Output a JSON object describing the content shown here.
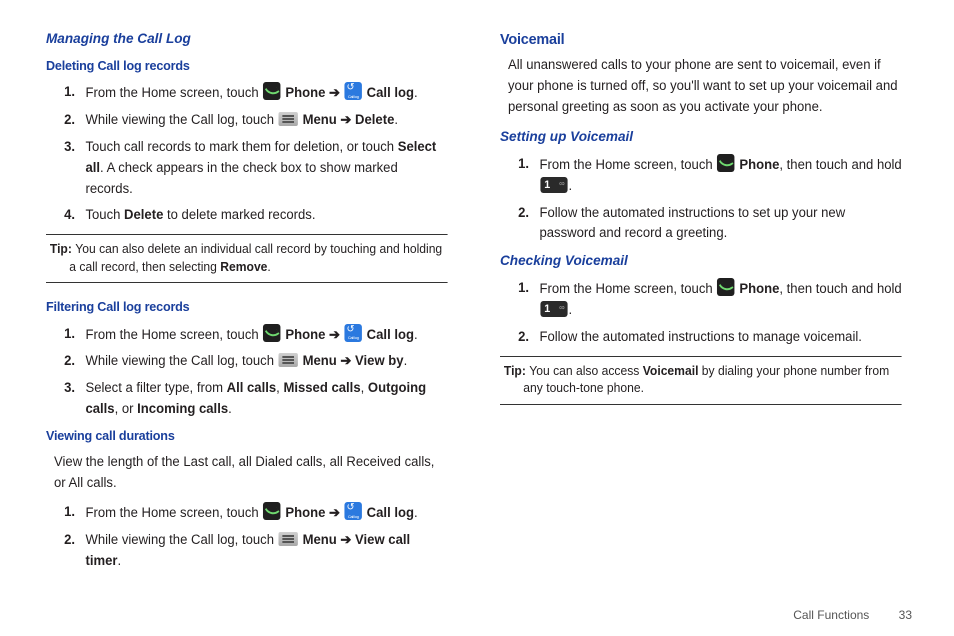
{
  "left": {
    "sectionTitle": "Managing the Call Log",
    "deleting": {
      "title": "Deleting Call log records",
      "steps": [
        {
          "pre": "From the Home screen, touch ",
          "icon1": "phone",
          "b1": " Phone ",
          "arrow": "➔",
          "icon2": "calllog",
          "b2": " Call log",
          "post": "."
        },
        {
          "pre": "While viewing the Call log, touch ",
          "icon1": "menu",
          "b1": " Menu ",
          "arrow": "➔",
          "b2": " Delete",
          "post": "."
        },
        {
          "text": "Touch call records to mark them for deletion, or touch ",
          "b1": "Select all",
          "post": ". A check appears in the check box to show marked records."
        },
        {
          "text": "Touch ",
          "b1": "Delete",
          "post": " to delete marked records."
        }
      ]
    },
    "tip": {
      "label": "Tip: ",
      "pre": "You can also delete an individual call record by touching and holding a call record, then selecting ",
      "b": "Remove",
      "post": "."
    },
    "filtering": {
      "title": "Filtering Call log records",
      "steps": [
        {
          "pre": "From the Home screen, touch ",
          "icon1": "phone",
          "b1": " Phone ",
          "arrow": "➔",
          "icon2": "calllog",
          "b2": " Call log",
          "post": "."
        },
        {
          "pre": "While viewing the Call log, touch ",
          "icon1": "menu",
          "b1": " Menu ",
          "arrow": "➔",
          "b2": " View by",
          "post": "."
        },
        {
          "text": "Select a filter type, from ",
          "b1": "All calls",
          "s1": ", ",
          "b2": "Missed calls",
          "s2": ", ",
          "b3": "Outgoing calls",
          "s3": ", or ",
          "b4": "Incoming calls",
          "post": "."
        }
      ]
    },
    "durations": {
      "title": "Viewing call durations",
      "intro": "View the length of the Last call, all Dialed calls, all Received calls, or All calls.",
      "steps": [
        {
          "pre": "From the Home screen, touch ",
          "icon1": "phone",
          "b1": " Phone ",
          "arrow": "➔",
          "icon2": "calllog",
          "b2": " Call log",
          "post": "."
        },
        {
          "pre": "While viewing the Call log, touch ",
          "icon1": "menu",
          "b1": " Menu ",
          "arrow": "➔",
          "b2": " View call timer",
          "post": "."
        }
      ]
    }
  },
  "right": {
    "title": "Voicemail",
    "intro": "All unanswered calls to your phone are sent to voicemail, even if your phone is turned off, so you'll want to set up your voicemail and personal greeting as soon as you activate your phone.",
    "setup": {
      "title": "Setting up Voicemail",
      "steps": [
        {
          "pre": "From the Home screen, touch ",
          "icon1": "phone",
          "b1": " Phone",
          "mid": ", then touch and hold ",
          "icon2": "key1",
          "post": "."
        },
        {
          "text": "Follow the automated instructions to set up your new password and record a greeting."
        }
      ]
    },
    "check": {
      "title": "Checking Voicemail",
      "steps": [
        {
          "pre": "From the Home screen, touch ",
          "icon1": "phone",
          "b1": " Phone",
          "mid": ", then touch and hold ",
          "icon2": "key1",
          "post": "."
        },
        {
          "text": "Follow the automated instructions to manage voicemail."
        }
      ]
    },
    "tip": {
      "label": "Tip: ",
      "pre": "You can also access ",
      "b": "Voicemail",
      "post": " by dialing your phone number from any touch-tone phone."
    }
  },
  "footer": {
    "section": "Call Functions",
    "page": "33"
  }
}
